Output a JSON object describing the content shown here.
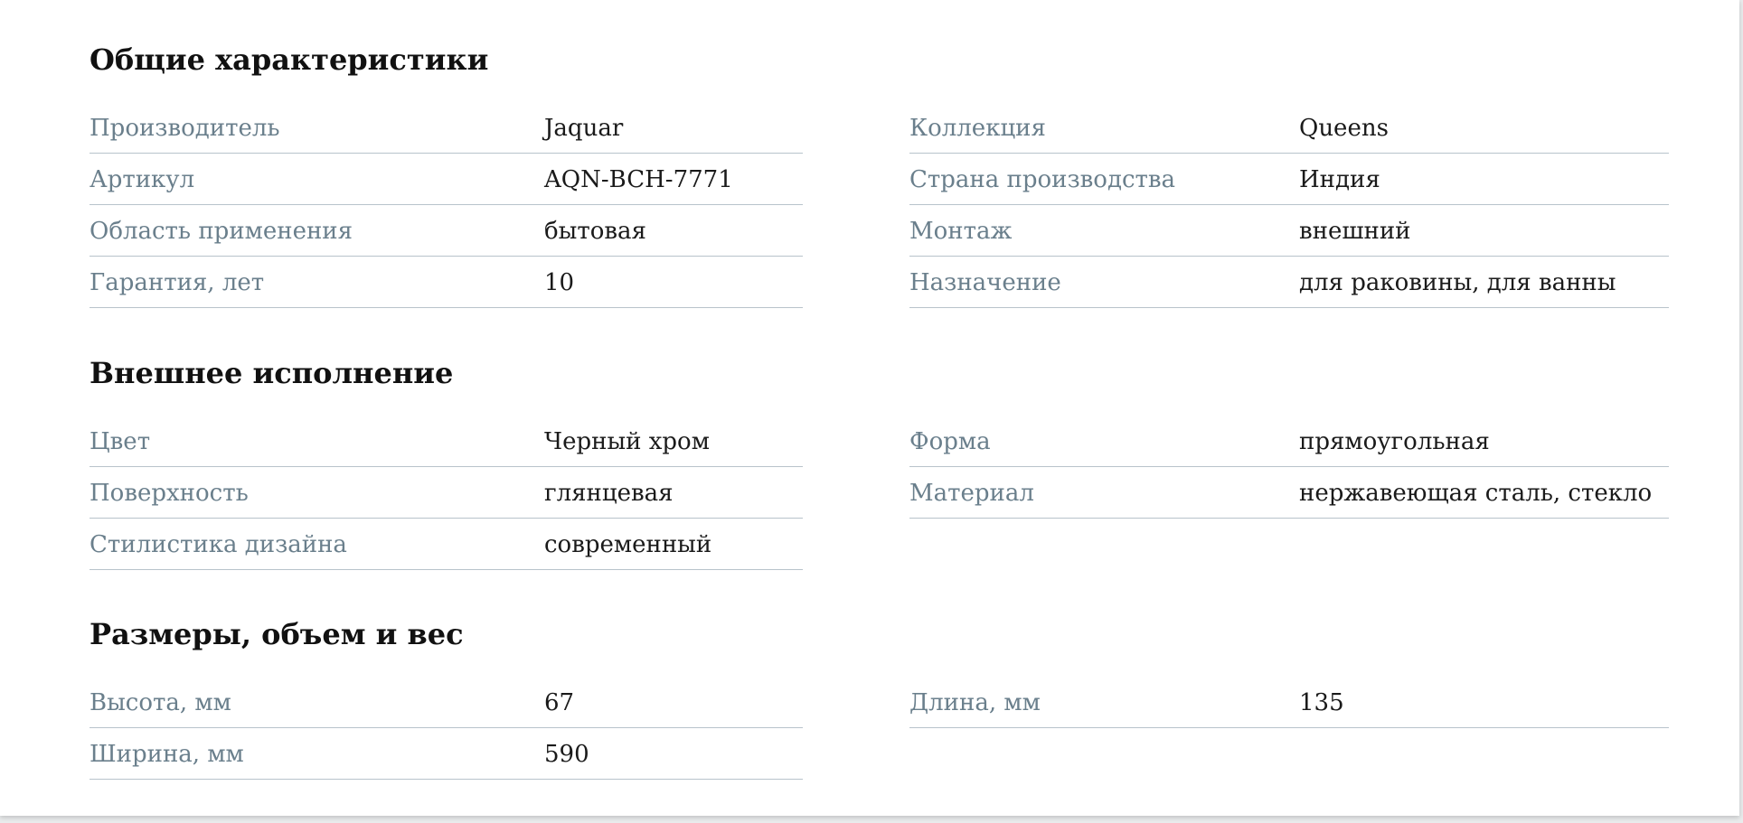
{
  "sections": [
    {
      "title": "Общие характеристики",
      "left": [
        {
          "label": "Производитель",
          "value": "Jaquar"
        },
        {
          "label": "Артикул",
          "value": "AQN-BCH-7771"
        },
        {
          "label": "Область применения",
          "value": "бытовая"
        },
        {
          "label": "Гарантия, лет",
          "value": "10"
        }
      ],
      "right": [
        {
          "label": "Коллекция",
          "value": "Queens"
        },
        {
          "label": "Страна производства",
          "value": "Индия"
        },
        {
          "label": "Монтаж",
          "value": "внешний"
        },
        {
          "label": "Назначение",
          "value": "для раковины, для ванны"
        }
      ]
    },
    {
      "title": "Внешнее исполнение",
      "left": [
        {
          "label": "Цвет",
          "value": "Черный хром"
        },
        {
          "label": "Поверхность",
          "value": "глянцевая"
        },
        {
          "label": "Стилистика дизайна",
          "value": "современный"
        }
      ],
      "right": [
        {
          "label": "Форма",
          "value": "прямоугольная"
        },
        {
          "label": "Материал",
          "value": "нержавеющая сталь, стекло"
        }
      ]
    },
    {
      "title": "Размеры, объем и вес",
      "left": [
        {
          "label": "Высота, мм",
          "value": "67"
        },
        {
          "label": "Ширина, мм",
          "value": "590"
        }
      ],
      "right": [
        {
          "label": "Длина, мм",
          "value": "135"
        }
      ]
    }
  ]
}
